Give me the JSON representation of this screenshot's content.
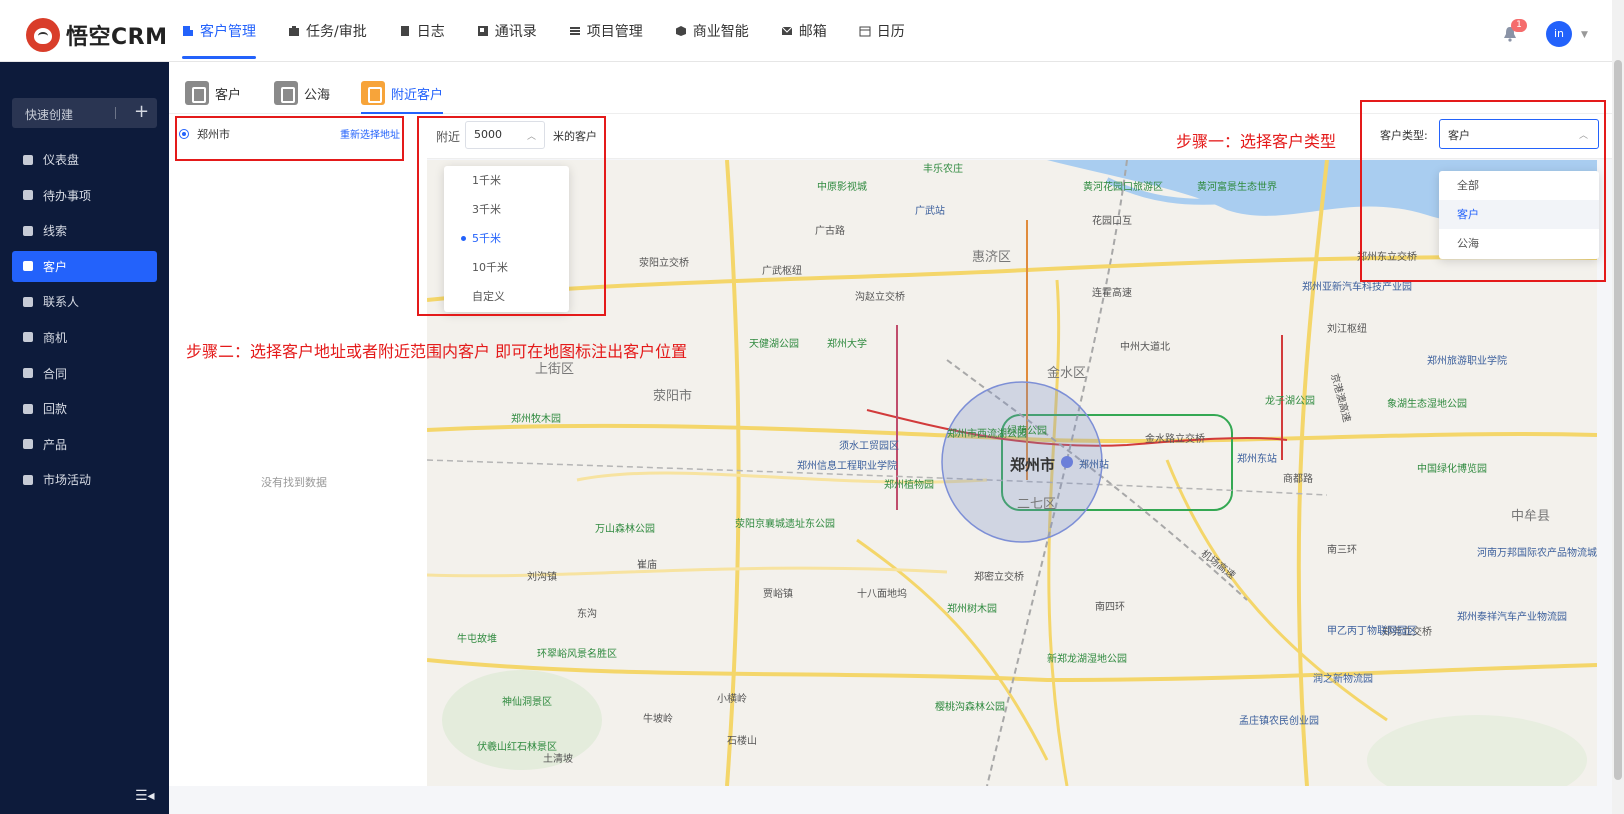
{
  "app": {
    "name": "悟空CRM"
  },
  "nav": [
    {
      "label": "客户管理",
      "icon": "building-icon",
      "active": true
    },
    {
      "label": "任务/审批",
      "icon": "briefcase-icon"
    },
    {
      "label": "日志",
      "icon": "notebook-icon"
    },
    {
      "label": "通讯录",
      "icon": "contacts-icon"
    },
    {
      "label": "项目管理",
      "icon": "list-icon"
    },
    {
      "label": "商业智能",
      "icon": "cube-icon"
    },
    {
      "label": "邮箱",
      "icon": "mail-icon"
    },
    {
      "label": "日历",
      "icon": "calendar-icon"
    }
  ],
  "header": {
    "notification_count": "1",
    "avatar_text": "in"
  },
  "sidebar": {
    "quick_create": "快速创建",
    "items": [
      {
        "label": "仪表盘",
        "icon": "dashboard-icon"
      },
      {
        "label": "待办事项",
        "icon": "chat-icon"
      },
      {
        "label": "线索",
        "icon": "leads-icon"
      },
      {
        "label": "客户",
        "icon": "building-icon",
        "active": true
      },
      {
        "label": "联系人",
        "icon": "contact-icon"
      },
      {
        "label": "商机",
        "icon": "opportunity-icon"
      },
      {
        "label": "合同",
        "icon": "contract-icon"
      },
      {
        "label": "回款",
        "icon": "money-bag-icon"
      },
      {
        "label": "产品",
        "icon": "product-icon"
      },
      {
        "label": "市场活动",
        "icon": "send-icon"
      }
    ]
  },
  "subtabs": [
    {
      "label": "客户",
      "icon": "customer-icon"
    },
    {
      "label": "公海",
      "icon": "pool-icon"
    },
    {
      "label": "附近客户",
      "icon": "nearby-icon",
      "active": true
    }
  ],
  "location": {
    "city": "郑州市",
    "reselect": "重新选择地址",
    "empty": "没有找到数据"
  },
  "range": {
    "prefix": "附近",
    "value": "5000",
    "suffix": "米的客户",
    "options": [
      "1千米",
      "3千米",
      "5千米",
      "10千米",
      "自定义"
    ],
    "selected": "5千米"
  },
  "customer_type": {
    "label": "客户类型:",
    "value": "客户",
    "options": [
      "全部",
      "客户",
      "公海"
    ],
    "highlighted": "客户"
  },
  "annotations": {
    "step1": "步骤一：选择客户类型",
    "step2": "步骤二：选择客户地址或者附近范围内客户 即可在地图标注出客户位置"
  },
  "map": {
    "districts": [
      "惠济区",
      "上街区",
      "荥阳市",
      "金水区",
      "二七区",
      "中牟县"
    ],
    "city": "郑州市",
    "roads": [
      "广古路",
      "花园口互",
      "连霍高速",
      "中州大道北",
      "金水路立交桥",
      "南三环",
      "南四环",
      "机场高速",
      "商都路",
      "京港澳高速",
      "广武枢纽",
      "荥阳立交桥",
      "沟赵立交桥",
      "郑州东立交桥",
      "刘江枢纽",
      "郑密立交桥",
      "郑尧立交桥",
      "十八面地坞",
      "贾峪镇",
      "崔庙",
      "东沟",
      "刘沟镇"
    ],
    "pois": [
      "郑州大学",
      "天健湖公园",
      "郑州市西流湖公园",
      "绿荫公园",
      "郑州站",
      "郑州东站",
      "郑州植物园",
      "郑州信息工程职业学院",
      "万山森林公园",
      "荥阳京襄城遗址东公园",
      "郑州树木园",
      "新郑龙湖湿地公园",
      "樱桃沟森林公园",
      "河南万邦国际农产品物流城",
      "郑州泰祥汽车产业物流园",
      "郑州旅游职业学院",
      "象湖生态湿地公园",
      "中国绿化博览园",
      "龙子湖公园",
      "郑州亚新汽车科技产业园",
      "黄河花园口旅游区",
      "黄河富景生态世界",
      "广武站",
      "中原影视城",
      "丰乐农庄",
      "郑州牧木园",
      "牛屯故堆",
      "环翠峪风景名胜区",
      "神仙洞景区",
      "伏羲山红石林景区",
      "土清坡",
      "石楼山",
      "牛坡岭",
      "小横岭",
      "孟庄镇农民创业园",
      "润之新物流园",
      "须水工贸园区",
      "甲乙丙丁物联网园区"
    ]
  }
}
